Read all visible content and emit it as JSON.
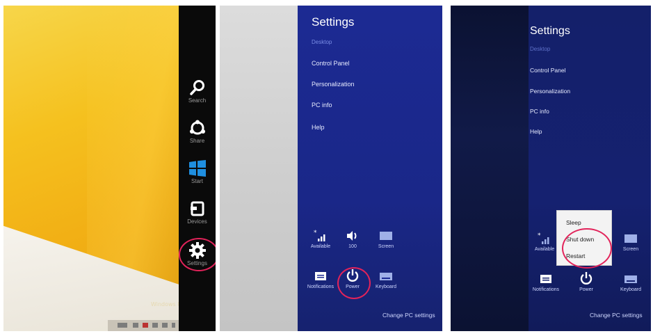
{
  "panel1": {
    "charms": [
      {
        "label": "Search",
        "icon": "search-icon"
      },
      {
        "label": "Share",
        "icon": "share-icon"
      },
      {
        "label": "Start",
        "icon": "windows-icon"
      },
      {
        "label": "Devices",
        "icon": "devices-icon"
      },
      {
        "label": "Settings",
        "icon": "gear-icon"
      }
    ],
    "desktop_text": "Windows 8"
  },
  "panel2": {
    "title": "Settings",
    "subtitle": "Desktop",
    "items": [
      "Control Panel",
      "Personalization",
      "PC info",
      "Help"
    ],
    "tiles": [
      {
        "label": "Available",
        "icon": "network-icon"
      },
      {
        "label": "100",
        "icon": "volume-icon"
      },
      {
        "label": "Screen",
        "icon": "screen-icon"
      },
      {
        "label": "Notifications",
        "icon": "notifications-icon"
      },
      {
        "label": "Power",
        "icon": "power-icon"
      },
      {
        "label": "Keyboard",
        "icon": "keyboard-icon"
      }
    ],
    "change_pc_settings": "Change PC settings"
  },
  "panel3": {
    "title": "Settings",
    "subtitle": "Desktop",
    "items": [
      "Control Panel",
      "Personalization",
      "PC info",
      "Help"
    ],
    "power_menu": [
      "Sleep",
      "Shut down",
      "Restart"
    ],
    "tiles": [
      {
        "label": "Available",
        "icon": "network-icon"
      },
      {
        "label": "Screen",
        "icon": "screen-icon"
      },
      {
        "label": "Notifications",
        "icon": "notifications-icon"
      },
      {
        "label": "Power",
        "icon": "power-icon"
      },
      {
        "label": "Keyboard",
        "icon": "keyboard-icon"
      }
    ],
    "change_pc_settings": "Change PC settings"
  },
  "colors": {
    "settings_pane": "#1c2a93",
    "desktop_yellow": "#f5c11f",
    "highlight_ring": "#e2235a",
    "charms_bar": "#0a0a0a"
  }
}
